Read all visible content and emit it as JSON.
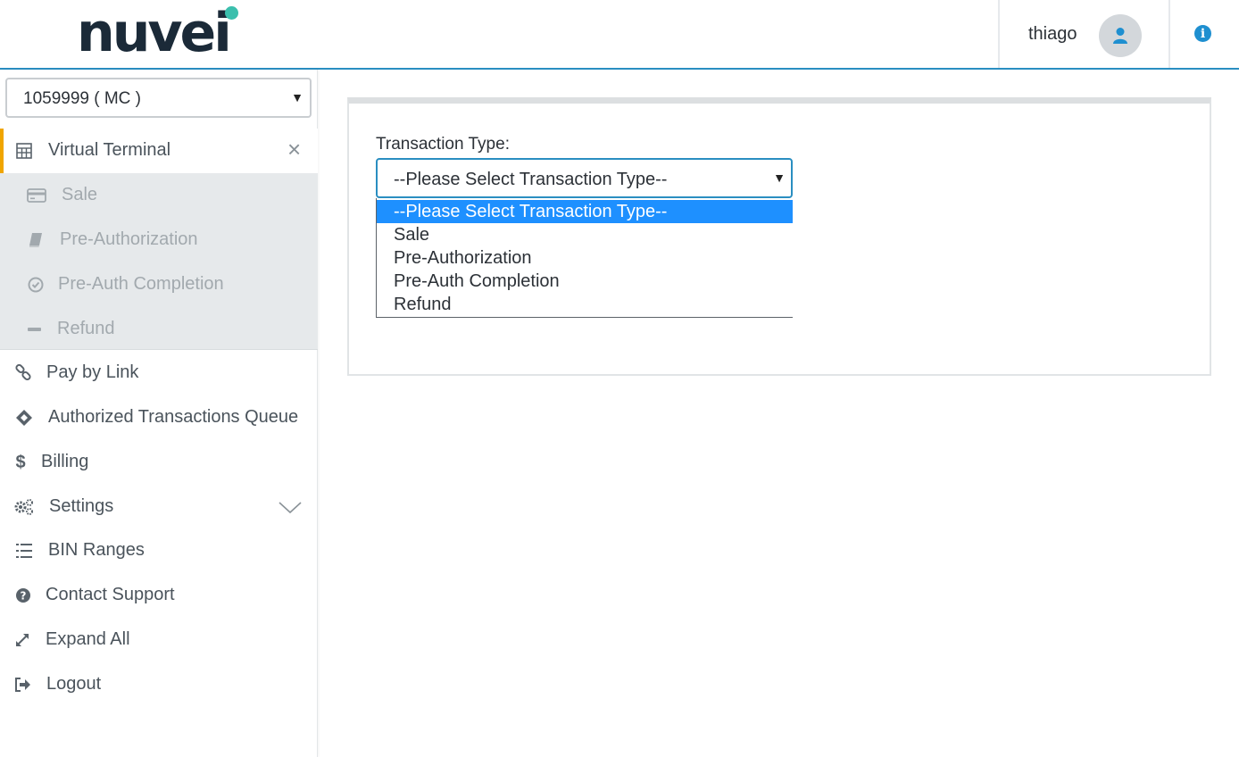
{
  "header": {
    "logo_text": "nuvei",
    "user_name": "thiago",
    "info_glyph": "i"
  },
  "sidebar": {
    "merchant_select": {
      "value": "1059999 ( MC )"
    },
    "virtual_terminal": {
      "label": "Virtual Terminal",
      "close": "×"
    },
    "submenu": [
      {
        "label": "Sale",
        "icon": "credit-card-icon"
      },
      {
        "label": "Pre-Authorization",
        "icon": "book-icon"
      },
      {
        "label": "Pre-Auth Completion",
        "icon": "check-circle-icon"
      },
      {
        "label": "Refund",
        "icon": "minus-icon"
      }
    ],
    "items": [
      {
        "label": "Pay by Link",
        "icon": "link-icon"
      },
      {
        "label": "Authorized Transactions Queue",
        "icon": "ticket-icon"
      },
      {
        "label": "Billing",
        "icon": "dollar-icon"
      },
      {
        "label": "Settings",
        "icon": "gears-icon"
      },
      {
        "label": "BIN Ranges",
        "icon": "list-ol-icon"
      },
      {
        "label": "Contact Support",
        "icon": "question-circle-icon"
      },
      {
        "label": "Expand All",
        "icon": "expand-icon"
      },
      {
        "label": "Logout",
        "icon": "sign-out-icon"
      }
    ]
  },
  "main": {
    "transaction_type_label": "Transaction Type:",
    "transaction_type_value": "--Please Select Transaction Type--",
    "options": [
      "--Please Select Transaction Type--",
      "Sale",
      "Pre-Authorization",
      "Pre-Auth Completion",
      "Refund"
    ]
  },
  "colors": {
    "accent_blue": "#2a8ec1",
    "active_marker": "#f0a500",
    "selected_option": "#1e90ff",
    "logo_dot": "#3bbfad"
  }
}
